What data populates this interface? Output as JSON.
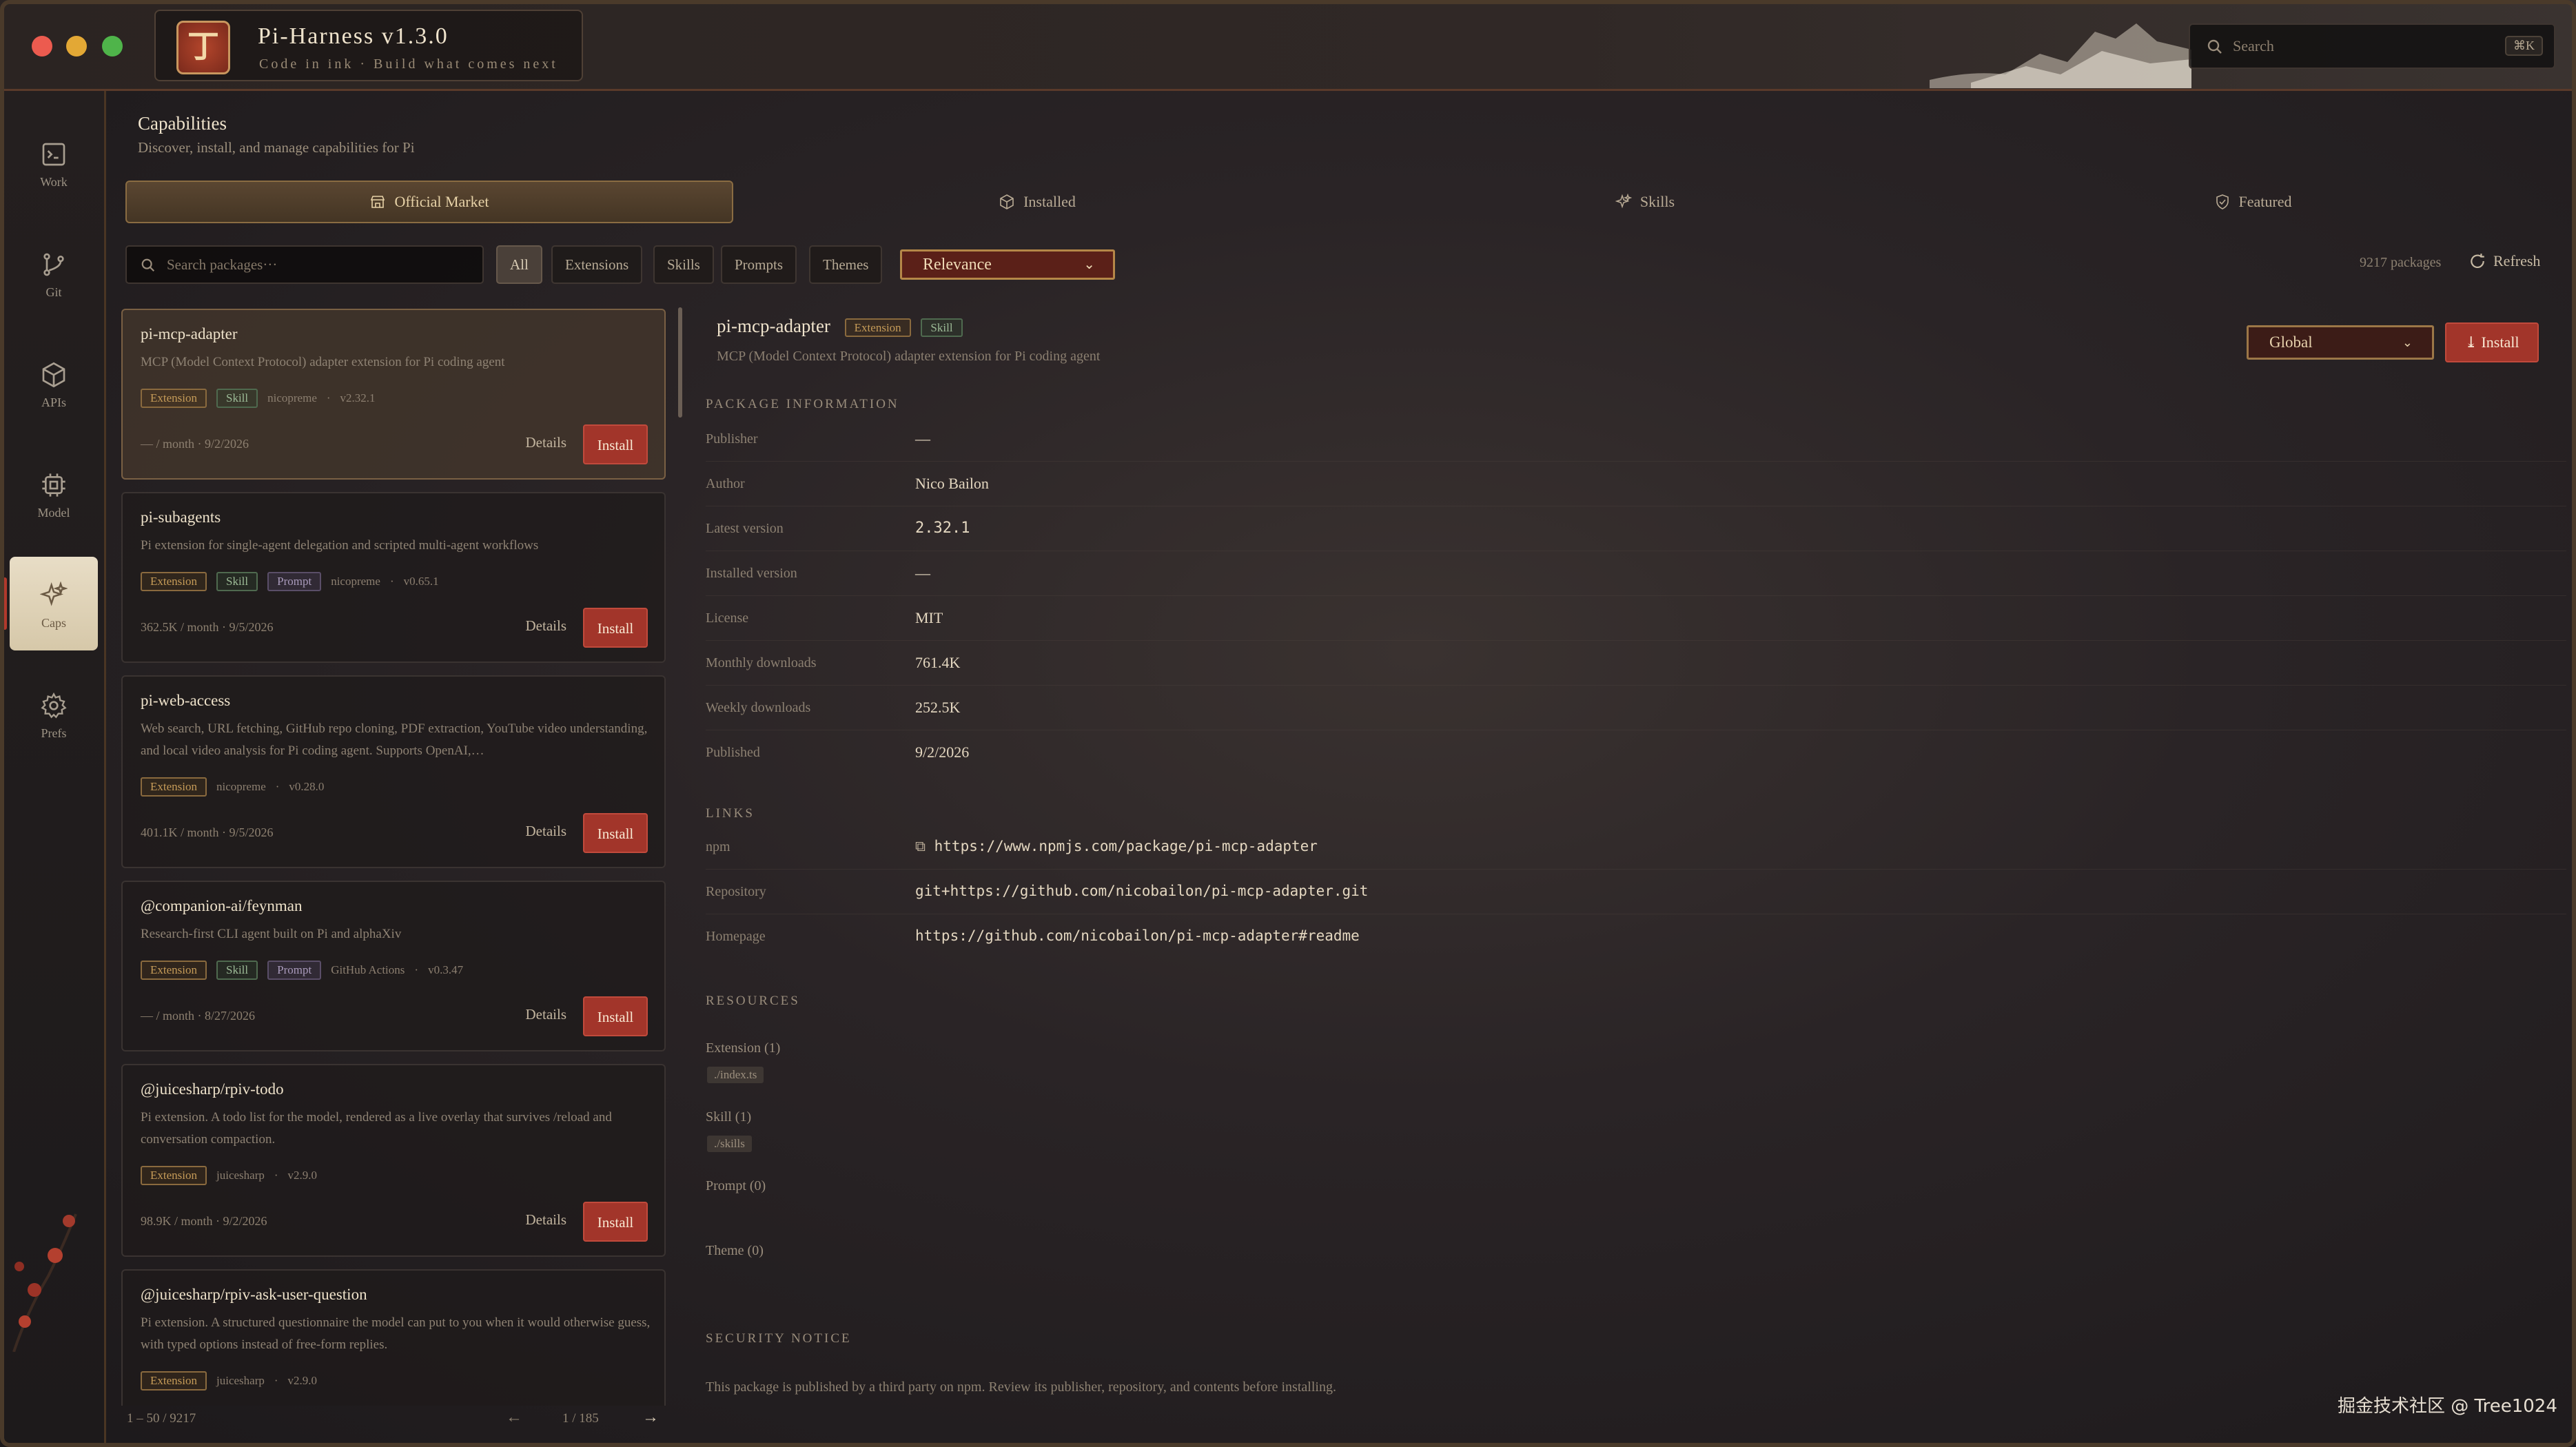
{
  "window": {
    "title": "Pi-Harness v1.3.0",
    "subtitle": "Code in ink · Build what comes next",
    "logo_glyph": "丁",
    "search_placeholder": "Search",
    "search_shortcut": "⌘K"
  },
  "rail": {
    "items": [
      {
        "label": "Work",
        "icon": "terminal-icon"
      },
      {
        "label": "Git",
        "icon": "git-branch-icon"
      },
      {
        "label": "APIs",
        "icon": "cube-icon"
      },
      {
        "label": "Model",
        "icon": "cpu-icon"
      },
      {
        "label": "Caps",
        "icon": "sparkles-icon",
        "active": true
      },
      {
        "label": "Prefs",
        "icon": "gear-icon"
      }
    ]
  },
  "header": {
    "title": "Capabilities",
    "subtitle": "Discover, install, and manage capabilities for Pi"
  },
  "tabs": [
    {
      "label": "Official Market",
      "icon": "store-icon",
      "active": true
    },
    {
      "label": "Installed",
      "icon": "box-icon"
    },
    {
      "label": "Skills",
      "icon": "sparkles-icon"
    },
    {
      "label": "Featured",
      "icon": "shield-check-icon"
    }
  ],
  "filters": {
    "search_placeholder": "Search packages···",
    "chips": [
      "All",
      "Extensions",
      "Skills",
      "Prompts",
      "Themes"
    ],
    "active_chip": "All",
    "sort": "Relevance",
    "count": "9217 packages",
    "refresh": "Refresh"
  },
  "packages": [
    {
      "name": "pi-mcp-adapter",
      "desc": "MCP (Model Context Protocol) adapter extension for Pi coding agent",
      "tags": [
        "Extension",
        "Skill"
      ],
      "author": "nicopreme",
      "version": "v2.32.1",
      "downloads": "— / month",
      "date": "9/2/2026",
      "details": "Details",
      "install": "Install"
    },
    {
      "name": "pi-subagents",
      "desc": "Pi extension for single-agent delegation and scripted multi-agent workflows",
      "tags": [
        "Extension",
        "Skill",
        "Prompt"
      ],
      "author": "nicopreme",
      "version": "v0.65.1",
      "downloads": "362.5K / month",
      "date": "9/5/2026",
      "details": "Details",
      "install": "Install"
    },
    {
      "name": "pi-web-access",
      "desc": "Web search, URL fetching, GitHub repo cloning, PDF extraction, YouTube video understanding, and local video analysis for Pi coding agent. Supports OpenAI,…",
      "tags": [
        "Extension"
      ],
      "author": "nicopreme",
      "version": "v0.28.0",
      "downloads": "401.1K / month",
      "date": "9/5/2026",
      "details": "Details",
      "install": "Install"
    },
    {
      "name": "@companion-ai/feynman",
      "desc": "Research-first CLI agent built on Pi and alphaXiv",
      "tags": [
        "Extension",
        "Skill",
        "Prompt"
      ],
      "author": "GitHub Actions",
      "version": "v0.3.47",
      "downloads": "— / month",
      "date": "8/27/2026",
      "details": "Details",
      "install": "Install"
    },
    {
      "name": "@juicesharp/rpiv-todo",
      "desc": "Pi extension. A todo list for the model, rendered as a live overlay that survives /reload and conversation compaction.",
      "tags": [
        "Extension"
      ],
      "author": "juicesharp",
      "version": "v2.9.0",
      "downloads": "98.9K / month",
      "date": "9/2/2026",
      "details": "Details",
      "install": "Install"
    },
    {
      "name": "@juicesharp/rpiv-ask-user-question",
      "desc": "Pi extension. A structured questionnaire the model can put to you when it would otherwise guess, with typed options instead of free-form replies.",
      "tags": [
        "Extension"
      ],
      "author": "juicesharp",
      "version": "v2.9.0"
    }
  ],
  "pager": {
    "range": "1 – 50 / 9217",
    "page": "1 / 185"
  },
  "detail": {
    "name": "pi-mcp-adapter",
    "tags": [
      "Extension",
      "Skill"
    ],
    "desc": "MCP (Model Context Protocol) adapter extension for Pi coding agent",
    "scope": "Global",
    "install": "Install",
    "info_title": "PACKAGE INFORMATION",
    "info": [
      {
        "k": "Publisher",
        "v": "—"
      },
      {
        "k": "Author",
        "v": "Nico Bailon"
      },
      {
        "k": "Latest version",
        "v": "2.32.1",
        "mono": true
      },
      {
        "k": "Installed version",
        "v": "—"
      },
      {
        "k": "License",
        "v": "MIT"
      },
      {
        "k": "Monthly downloads",
        "v": "761.4K"
      },
      {
        "k": "Weekly downloads",
        "v": "252.5K"
      },
      {
        "k": "Published",
        "v": "9/2/2026"
      }
    ],
    "links_title": "LINKS",
    "links": [
      {
        "k": "npm",
        "v": "https://www.npmjs.com/package/pi-mcp-adapter",
        "external": true
      },
      {
        "k": "Repository",
        "v": "git+https://github.com/nicobailon/pi-mcp-adapter.git"
      },
      {
        "k": "Homepage",
        "v": "https://github.com/nicobailon/pi-mcp-adapter#readme"
      }
    ],
    "resources_title": "RESOURCES",
    "resources": [
      {
        "label": "Extension (1)",
        "items": [
          "./index.ts"
        ]
      },
      {
        "label": "Skill (1)",
        "items": [
          "./skills"
        ]
      },
      {
        "label": "Prompt (0)",
        "items": []
      },
      {
        "label": "Theme (0)",
        "items": []
      }
    ],
    "security_title": "SECURITY NOTICE",
    "security_text": "This package is published by a third party on npm. Review its publisher, repository, and contents before installing."
  },
  "watermark": "掘金技术社区 @ Tree1024",
  "colors": {
    "accent": "#a2352a",
    "gold": "#b58748",
    "bg": "#1f1b1c"
  }
}
